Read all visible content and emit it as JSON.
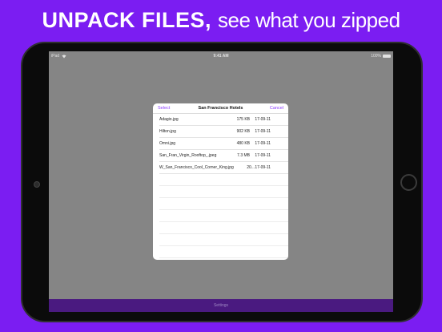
{
  "headline": {
    "bold": "UNPACK FILES,",
    "light": "see what you zipped"
  },
  "status": {
    "device": "iPad",
    "wifi_icon": "wifi-icon",
    "time": "9:41 AM",
    "battery": "100%"
  },
  "dialog": {
    "select_label": "Select",
    "title": "San Francisco Hotels",
    "cancel_label": "Cancel",
    "files": [
      {
        "name": "Adagio.jpg",
        "size": "175 KB",
        "date": "17-09-11"
      },
      {
        "name": "Hilton.jpg",
        "size": "902 KB",
        "date": "17-09-11"
      },
      {
        "name": "Omni.jpg",
        "size": "480 KB",
        "date": "17-09-11"
      },
      {
        "name": "San_Fran_Virgin_Rooftop_.jpeg",
        "size": "7.3 MB",
        "date": "17-09-11"
      },
      {
        "name": "W_San_Francisco_Cool_Corner_King.jpg",
        "size": "20...",
        "date": "17-09-11"
      }
    ]
  },
  "bottombar": {
    "label": "Settings"
  },
  "colors": {
    "background": "#7b1df2",
    "accent": "#8c3bff",
    "bottombar": "#4a1a80"
  }
}
